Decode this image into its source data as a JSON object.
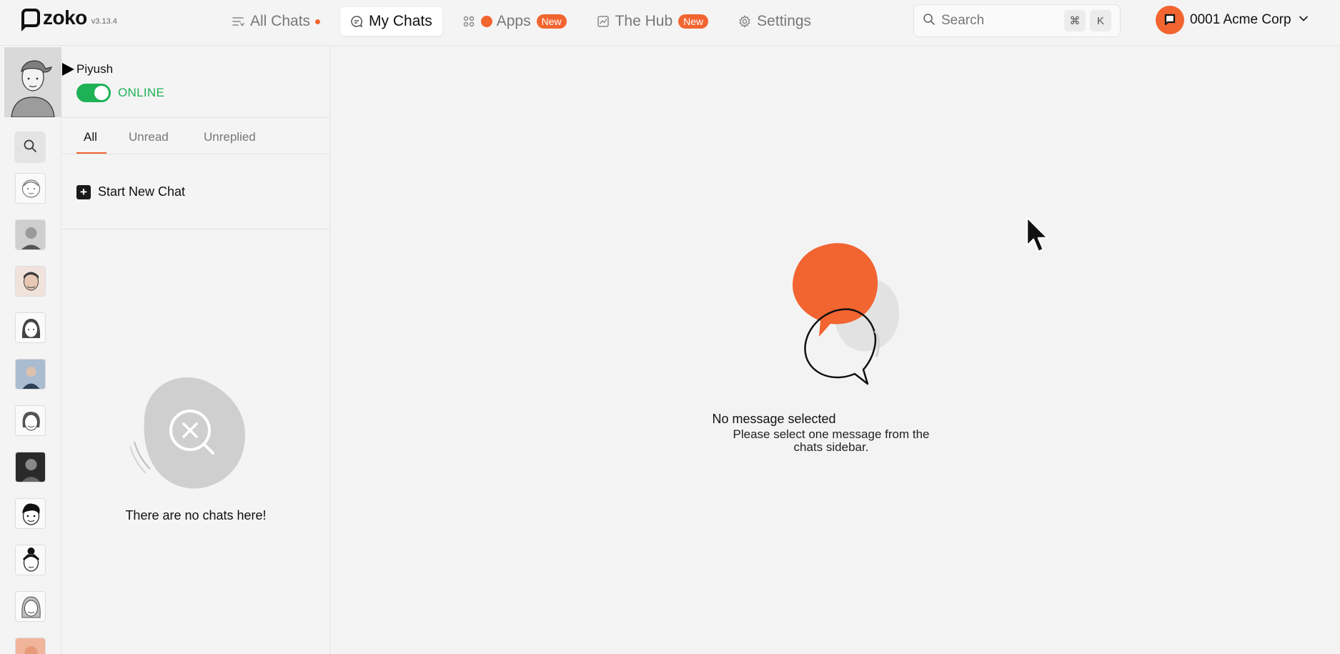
{
  "app": {
    "logo_text": "zoko",
    "version": "v3.13.4",
    "brand_color": "#f26430",
    "online_color": "#1fb156"
  },
  "nav": {
    "all_chats": "All Chats",
    "my_chats": "My Chats",
    "apps": "Apps",
    "apps_badge": "New",
    "hub": "The Hub",
    "hub_badge": "New",
    "settings": "Settings"
  },
  "search": {
    "placeholder": "Search",
    "key_cmd": "⌘",
    "key_k": "K"
  },
  "account": {
    "name": "0001 Acme Corp"
  },
  "user": {
    "name": "Piyush",
    "status": "ONLINE"
  },
  "tabs": [
    {
      "label": "All",
      "active": true
    },
    {
      "label": "Unread",
      "active": false
    },
    {
      "label": "Unreplied",
      "active": false
    }
  ],
  "panel": {
    "start_new_chat": "Start New Chat",
    "empty_message": "There are no chats here!"
  },
  "main": {
    "title": "No message selected",
    "subtitle": "Please select one message from the chats sidebar."
  },
  "icons": {
    "nav_all_chats": "list-icon",
    "nav_my_chats": "chat-bubble-icon",
    "nav_apps": "grid-icon",
    "nav_hub": "chart-icon",
    "nav_settings": "gear-icon",
    "search": "search-icon",
    "dropdown": "chevron-down-icon"
  }
}
